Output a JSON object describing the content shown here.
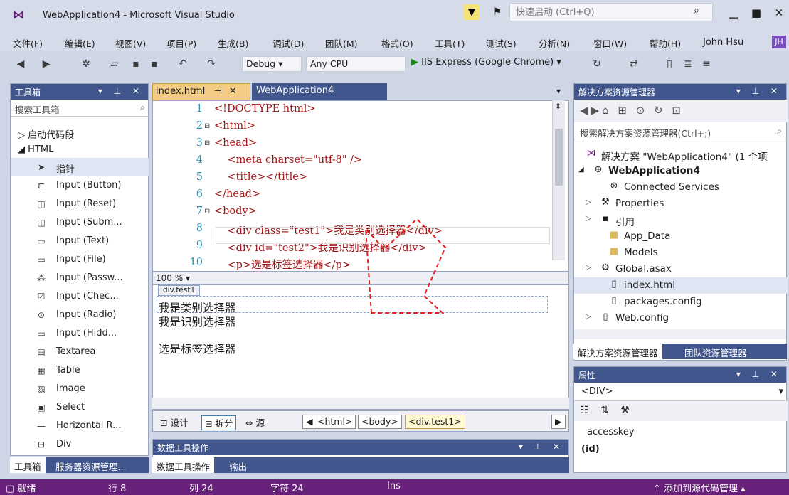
{
  "window": {
    "title": "WebApplication4 - Microsoft Visual Studio",
    "quicklaunch_placeholder": "快速启动 (Ctrl+Q)",
    "user": "John Hsu",
    "user_initials": "JH"
  },
  "menu": [
    "文件(F)",
    "编辑(E)",
    "视图(V)",
    "项目(P)",
    "生成(B)",
    "调试(D)",
    "团队(M)",
    "格式(O)",
    "工具(T)",
    "测试(S)",
    "分析(N)",
    "窗口(W)",
    "帮助(H)"
  ],
  "toolbar": {
    "config": "Debug",
    "platform": "Any CPU",
    "run_target": "IIS Express (Google Chrome)"
  },
  "toolbox": {
    "title": "工具箱",
    "search_placeholder": "搜索工具箱",
    "groups": [
      "启动代码段",
      "HTML"
    ],
    "items": [
      {
        "icon": "pointer-icon",
        "label": "指针"
      },
      {
        "icon": "input-button-icon",
        "label": "Input (Button)"
      },
      {
        "icon": "input-reset-icon",
        "label": "Input (Reset)"
      },
      {
        "icon": "input-submit-icon",
        "label": "Input (Subm..."
      },
      {
        "icon": "input-text-icon",
        "label": "Input (Text)"
      },
      {
        "icon": "input-file-icon",
        "label": "Input (File)"
      },
      {
        "icon": "input-password-icon",
        "label": "Input (Passw..."
      },
      {
        "icon": "checkbox-icon",
        "label": "Input (Chec..."
      },
      {
        "icon": "radio-icon",
        "label": "Input (Radio)"
      },
      {
        "icon": "hidden-icon",
        "label": "Input (Hidd..."
      },
      {
        "icon": "textarea-icon",
        "label": "Textarea"
      },
      {
        "icon": "table-icon",
        "label": "Table"
      },
      {
        "icon": "image-icon",
        "label": "Image"
      },
      {
        "icon": "select-icon",
        "label": "Select"
      },
      {
        "icon": "horizontal-rule-icon",
        "label": "Horizontal R..."
      },
      {
        "icon": "div-icon",
        "label": "Div"
      }
    ],
    "tabs": [
      "工具箱",
      "服务器资源管理..."
    ]
  },
  "editor": {
    "tabs": [
      "index.html",
      "WebApplication4"
    ],
    "lines": [
      {
        "n": "1",
        "text": "<!DOCTYPE html>"
      },
      {
        "n": "2",
        "text": "<html>"
      },
      {
        "n": "3",
        "text": "<head>"
      },
      {
        "n": "4",
        "text": "    <meta charset=\"utf-8\" />"
      },
      {
        "n": "5",
        "text": "    <title></title>"
      },
      {
        "n": "6",
        "text": "</head>"
      },
      {
        "n": "7",
        "text": "<body>"
      },
      {
        "n": "8",
        "text": "    <div class=\"test1\">我是类别选择器</div>"
      },
      {
        "n": "9",
        "text": "    <div id=\"test2\">我是识别选择器</div>"
      },
      {
        "n": "10",
        "text": "    <p>选是标签选择器</p>"
      }
    ],
    "zoom": "100 %"
  },
  "design": {
    "selected_tag": "div.test1",
    "texts": [
      "我是类别选择器",
      "我是识别选择器",
      "选是标签选择器"
    ]
  },
  "viewbar": {
    "design": "设计",
    "split": "拆分",
    "source": "源",
    "crumbs": [
      "<html>",
      "<body>",
      "<div.test1>"
    ]
  },
  "output": {
    "title": "数据工具操作",
    "tabs": [
      "数据工具操作",
      "输出"
    ]
  },
  "solution": {
    "title": "解决方案资源管理器",
    "search_placeholder": "搜索解决方案资源管理器(Ctrl+;)",
    "nodes": [
      {
        "label": "解决方案 \"WebApplication4\" (1 个项",
        "icon": "solution-icon"
      },
      {
        "label": "WebApplication4",
        "icon": "project-icon"
      },
      {
        "label": "Connected Services",
        "icon": "connected-services-icon"
      },
      {
        "label": "Properties",
        "icon": "wrench-icon"
      },
      {
        "label": "引用",
        "icon": "references-icon"
      },
      {
        "label": "App_Data",
        "icon": "folder-icon"
      },
      {
        "label": "Models",
        "icon": "folder-icon"
      },
      {
        "label": "Global.asax",
        "icon": "asax-icon"
      },
      {
        "label": "index.html",
        "icon": "html-file-icon"
      },
      {
        "label": "packages.config",
        "icon": "config-file-icon"
      },
      {
        "label": "Web.config",
        "icon": "config-file-icon"
      }
    ],
    "tabs": [
      "解决方案资源管理器",
      "团队资源管理器"
    ]
  },
  "properties": {
    "title": "属性",
    "selected": "<DIV>",
    "key": "accesskey",
    "desc": "(id)"
  },
  "status": {
    "ready": "就绪",
    "line": "行 8",
    "col": "列 24",
    "char": "字符 24",
    "mode": "Ins",
    "source_control": "添加到源代码管理"
  }
}
